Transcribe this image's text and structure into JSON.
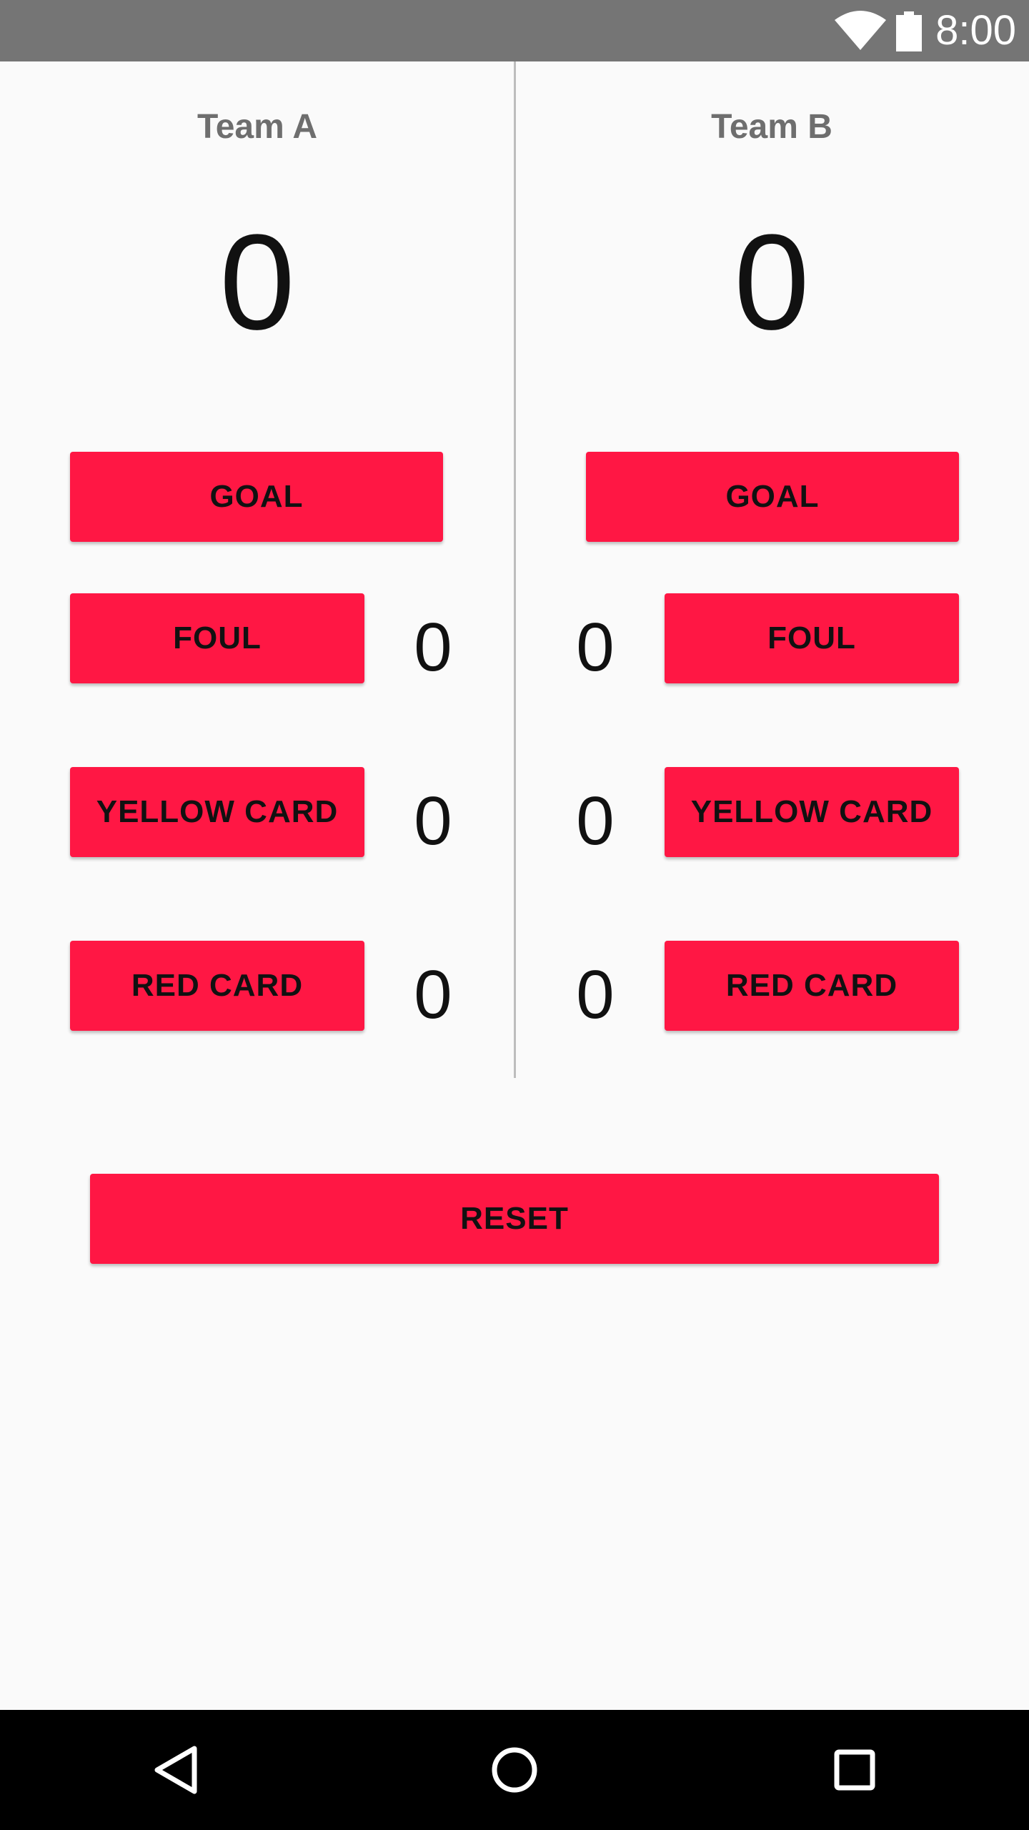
{
  "status_bar": {
    "time": "8:00",
    "wifi_icon": "wifi-icon",
    "battery_icon": "battery-icon"
  },
  "team_a": {
    "title": "Team A",
    "score": "0",
    "goal_label": "GOAL",
    "foul_label": "FOUL",
    "foul_count": "0",
    "yellow_label": "YELLOW CARD",
    "yellow_count": "0",
    "red_label": "RED CARD",
    "red_count": "0"
  },
  "team_b": {
    "title": "Team B",
    "score": "0",
    "goal_label": "GOAL",
    "foul_label": "FOUL",
    "foul_count": "0",
    "yellow_label": "YELLOW CARD",
    "yellow_count": "0",
    "red_label": "RED CARD",
    "red_count": "0"
  },
  "reset_label": "RESET",
  "nav_bar": {
    "back_icon": "back-triangle-icon",
    "home_icon": "home-circle-icon",
    "recents_icon": "recents-square-icon"
  },
  "colors": {
    "accent": "#ff1744",
    "status_bar": "#757575",
    "background": "#fafafa",
    "nav_bar": "#000000"
  }
}
